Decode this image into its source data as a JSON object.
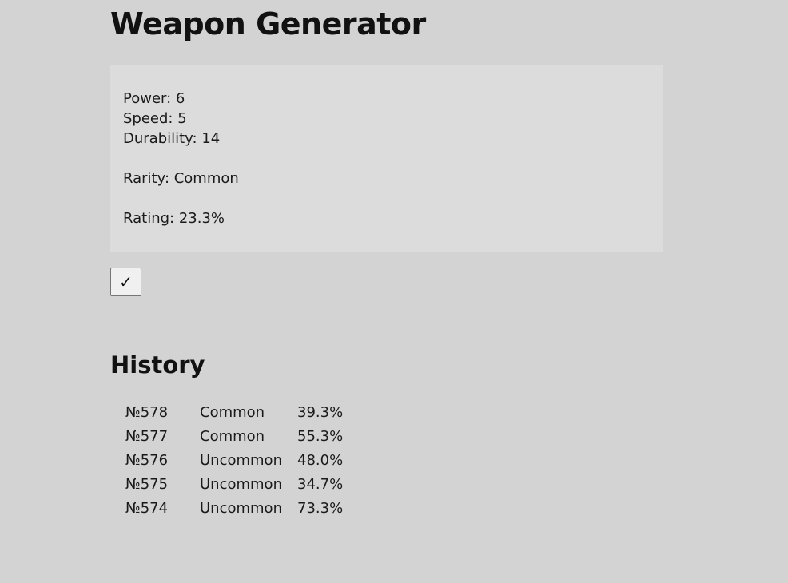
{
  "page": {
    "title": "Weapon Generator"
  },
  "stats": {
    "power": "Power: 6",
    "speed": "Speed: 5",
    "durability": "Durability: 14",
    "rarity": "Rarity: Common",
    "rating": "Rating: 23.3%"
  },
  "confirm_button": {
    "label": "✓",
    "icon": "checkmark-icon"
  },
  "history": {
    "title": "History",
    "rows": [
      {
        "id": "№578",
        "rarity": "Common",
        "rating": "39.3%"
      },
      {
        "id": "№577",
        "rarity": "Common",
        "rating": "55.3%"
      },
      {
        "id": "№576",
        "rarity": "Uncommon",
        "rating": "48.0%"
      },
      {
        "id": "№575",
        "rarity": "Uncommon",
        "rating": "34.7%"
      },
      {
        "id": "№574",
        "rarity": "Uncommon",
        "rating": "73.3%"
      }
    ]
  },
  "colors": {
    "background": "#d3d3d3",
    "panel": "#dcdcdc",
    "text": "#1a1a1a"
  }
}
